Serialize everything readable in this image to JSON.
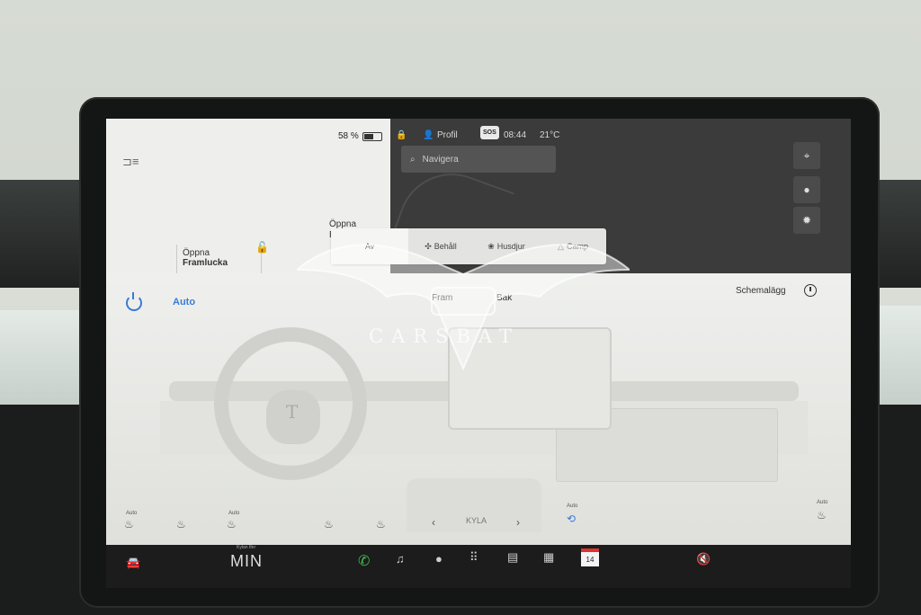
{
  "status": {
    "battery_percent": "58 %",
    "battery_level": 0.58,
    "profile_label": "Profil",
    "sos_label": "SOS",
    "time": "08:44",
    "temperature": "21°C"
  },
  "car": {
    "frunk_line1": "Öppna",
    "frunk_line2": "Framlucka",
    "trunk_line1": "Öppna",
    "trunk_line2": "Ba"
  },
  "map": {
    "search_placeholder": "Navigera"
  },
  "modes": {
    "items": [
      "Av",
      "Behåll",
      "Husdjur",
      "Camp"
    ],
    "active": "Av"
  },
  "airflow": {
    "front": "Fram",
    "rear": "Bak"
  },
  "climate": {
    "auto_label": "Auto",
    "schedule_label": "Schemalägg",
    "fan_label": "KYLA",
    "auto_tiny": "Auto"
  },
  "watermark": {
    "text": "CARSBAT"
  },
  "taskbar": {
    "temp_mode_small": "Kylan Ifer",
    "temp_value": "MIN",
    "calendar_day": "14"
  },
  "colors": {
    "accent_blue": "#3a7bd5",
    "phone_green": "#3fbf55",
    "calendar_red": "#dd3333"
  }
}
